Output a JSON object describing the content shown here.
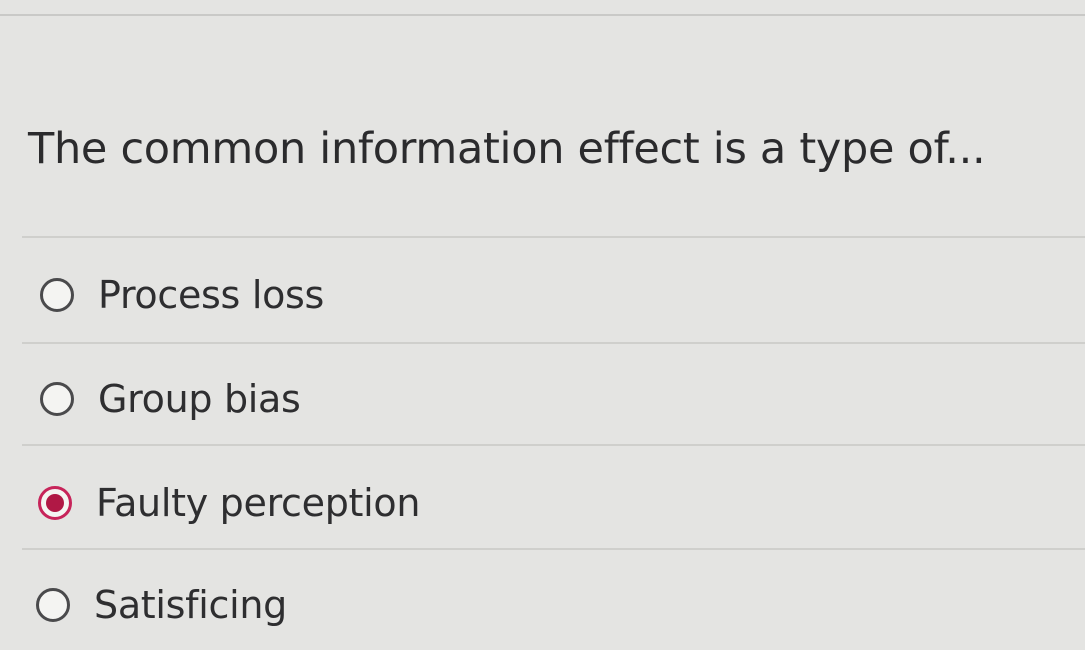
{
  "question": {
    "text": "The common information effect is a type of..."
  },
  "options": [
    {
      "label": "Process loss",
      "selected": false
    },
    {
      "label": "Group bias",
      "selected": false
    },
    {
      "label": "Faulty perception",
      "selected": true
    },
    {
      "label": "Satisficing",
      "selected": false
    }
  ],
  "colors": {
    "background": "#e4e4e2",
    "text": "#2e2e30",
    "selected_accent": "#c7245a",
    "divider": "#cfcfcc"
  }
}
